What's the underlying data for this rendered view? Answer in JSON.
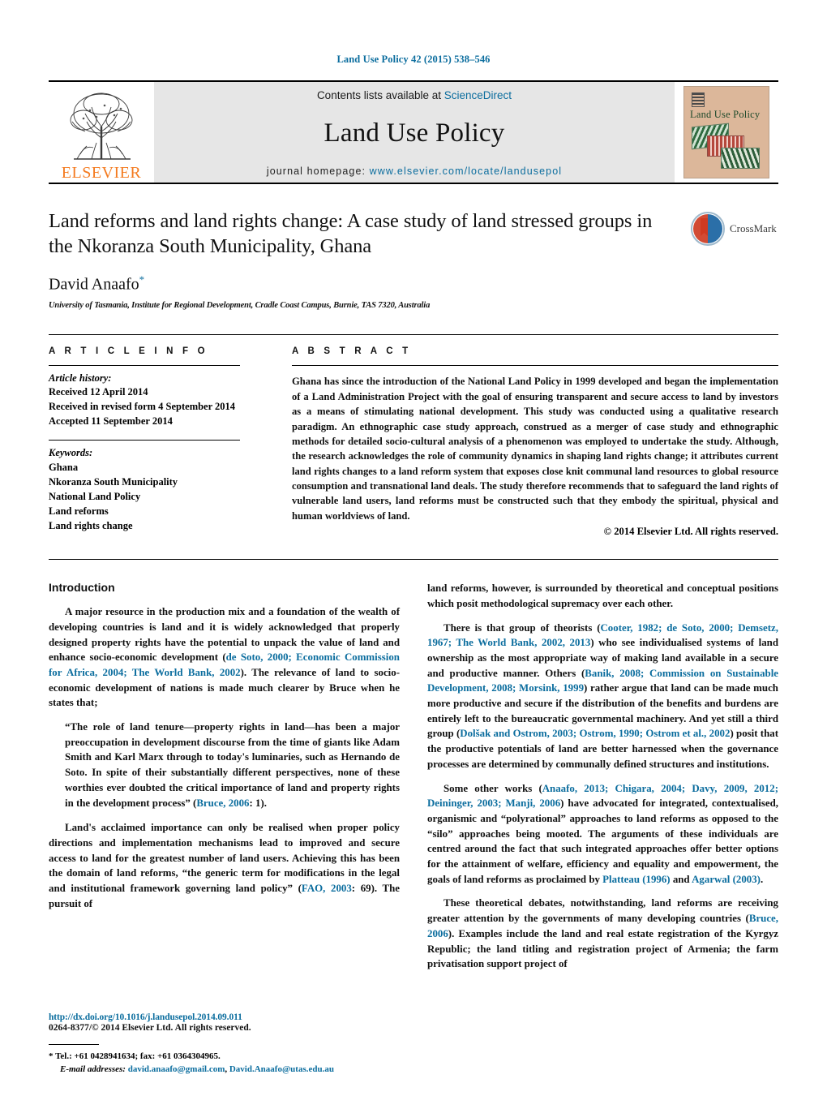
{
  "running_head": "Land Use Policy 42 (2015) 538–546",
  "masthead": {
    "publisher_name": "ELSEVIER",
    "contents_prefix": "Contents lists available at ",
    "contents_link": "ScienceDirect",
    "journal_name": "Land Use Policy",
    "homepage_prefix": "journal homepage: ",
    "homepage_url": "www.elsevier.com/locate/landusepol",
    "cover_title": "Land Use Policy"
  },
  "article": {
    "title": "Land reforms and land rights change: A case study of land stressed groups in the Nkoranza South Municipality, Ghana",
    "author": "David Anaafo",
    "author_marker": "*",
    "affiliation": "University of Tasmania, Institute for Regional Development, Cradle Coast Campus, Burnie, TAS 7320, Australia",
    "crossmark_label": "CrossMark"
  },
  "article_info": {
    "heading": "A R T I C L E   I N F O",
    "history_label": "Article history:",
    "history": [
      "Received 12 April 2014",
      "Received in revised form 4 September 2014",
      "Accepted 11 September 2014"
    ],
    "keywords_label": "Keywords:",
    "keywords": [
      "Ghana",
      "Nkoranza South Municipality",
      "National Land Policy",
      "Land reforms",
      "Land rights change"
    ]
  },
  "abstract": {
    "heading": "A B S T R A C T",
    "text": "Ghana has since the introduction of the National Land Policy in 1999 developed and began the implementation of a Land Administration Project with the goal of ensuring transparent and secure access to land by investors as a means of stimulating national development. This study was conducted using a qualitative research paradigm. An ethnographic case study approach, construed as a merger of case study and ethnographic methods for detailed socio-cultural analysis of a phenomenon was employed to undertake the study. Although, the research acknowledges the role of community dynamics in shaping land rights change; it attributes current land rights changes to a land reform system that exposes close knit communal land resources to global resource consumption and transnational land deals. The study therefore recommends that to safeguard the land rights of vulnerable land users, land reforms must be constructed such that they embody the spiritual, physical and human worldviews of land.",
    "copyright": "© 2014 Elsevier Ltd. All rights reserved."
  },
  "body": {
    "section_title": "Introduction",
    "left_paragraphs": [
      {
        "type": "para",
        "runs": [
          {
            "t": "A major resource in the production mix and a foundation of the wealth of developing countries is land and it is widely acknowledged that properly designed property rights have the potential to unpack the value of land and enhance socio-economic development ("
          },
          {
            "t": "de Soto, 2000; Economic Commission for Africa, 2004; The World Bank, 2002",
            "ref": true
          },
          {
            "t": "). The relevance of land to socio-economic development of nations is made much clearer by Bruce when he states that;"
          }
        ]
      },
      {
        "type": "quote",
        "runs": [
          {
            "t": "“The role of land tenure—property rights in land—has been a major preoccupation in development discourse from the time of giants like Adam Smith and Karl Marx through to today's luminaries, such as Hernando de Soto. In spite of their substantially different perspectives, none of these worthies ever doubted the critical importance of land and property rights in the development process” ("
          },
          {
            "t": "Bruce, 2006",
            "ref": true
          },
          {
            "t": ": 1)."
          }
        ]
      },
      {
        "type": "para",
        "runs": [
          {
            "t": "Land's acclaimed importance can only be realised when proper policy directions and implementation mechanisms lead to improved and secure access to land for the greatest number of land users. Achieving this has been the domain of land reforms, “the generic term for modifications in the legal and institutional framework governing land policy” ("
          },
          {
            "t": "FAO, 2003",
            "ref": true
          },
          {
            "t": ": 69). The pursuit of"
          }
        ]
      }
    ],
    "right_paragraphs": [
      {
        "type": "para",
        "indent": false,
        "runs": [
          {
            "t": "land reforms, however, is surrounded by theoretical and conceptual positions which posit methodological supremacy over each other."
          }
        ]
      },
      {
        "type": "para",
        "runs": [
          {
            "t": "There is that group of theorists ("
          },
          {
            "t": "Cooter, 1982; de Soto, 2000; Demsetz, 1967; The World Bank, 2002, 2013",
            "ref": true
          },
          {
            "t": ") who see individualised systems of land ownership as the most appropriate way of making land available in a secure and productive manner. Others ("
          },
          {
            "t": "Banik, 2008; Commission on Sustainable Development, 2008; Morsink, 1999",
            "ref": true
          },
          {
            "t": ") rather argue that land can be made much more productive and secure if the distribution of the benefits and burdens are entirely left to the bureaucratic governmental machinery. And yet still a third group ("
          },
          {
            "t": "Dolšak and Ostrom, 2003; Ostrom, 1990; Ostrom et al., 2002",
            "ref": true
          },
          {
            "t": ") posit that the productive potentials of land are better harnessed when the governance processes are determined by communally defined structures and institutions."
          }
        ]
      },
      {
        "type": "para",
        "runs": [
          {
            "t": "Some other works ("
          },
          {
            "t": "Anaafo, 2013; Chigara, 2004; Davy, 2009, 2012; Deininger, 2003; Manji, 2006",
            "ref": true
          },
          {
            "t": ") have advocated for integrated, contextualised, organismic and “polyrational” approaches to land reforms as opposed to the “silo” approaches being mooted. The arguments of these individuals are centred around the fact that such integrated approaches offer better options for the attainment of welfare, efficiency and equality and empowerment, the goals of land reforms as proclaimed by "
          },
          {
            "t": "Platteau (1996)",
            "ref": true
          },
          {
            "t": " and "
          },
          {
            "t": "Agarwal (2003)",
            "ref": true
          },
          {
            "t": "."
          }
        ]
      },
      {
        "type": "para",
        "runs": [
          {
            "t": "These theoretical debates, notwithstanding, land reforms are receiving greater attention by the governments of many developing countries ("
          },
          {
            "t": "Bruce, 2006",
            "ref": true
          },
          {
            "t": "). Examples include the land and real estate registration of the Kyrgyz Republic; the land titling and registration project of Armenia; the farm privatisation support project of"
          }
        ]
      }
    ]
  },
  "footnote": {
    "marker": "*",
    "contact": "Tel.: +61 0428941634; fax: +61 0364304965.",
    "email_label": "E-mail addresses:",
    "emails": [
      "david.anaafo@gmail.com",
      "David.Anaafo@utas.edu.au"
    ],
    "email_separator": ", "
  },
  "footer": {
    "doi": "http://dx.doi.org/10.1016/j.landusepol.2014.09.011",
    "issn": "0264-8377/© 2014 Elsevier Ltd. All rights reserved."
  },
  "colors": {
    "link": "#0b6d9e",
    "elsevier_orange": "#f47b20",
    "masthead_bg": "#e6e6e6",
    "cover_bg": "#dcb79a"
  }
}
